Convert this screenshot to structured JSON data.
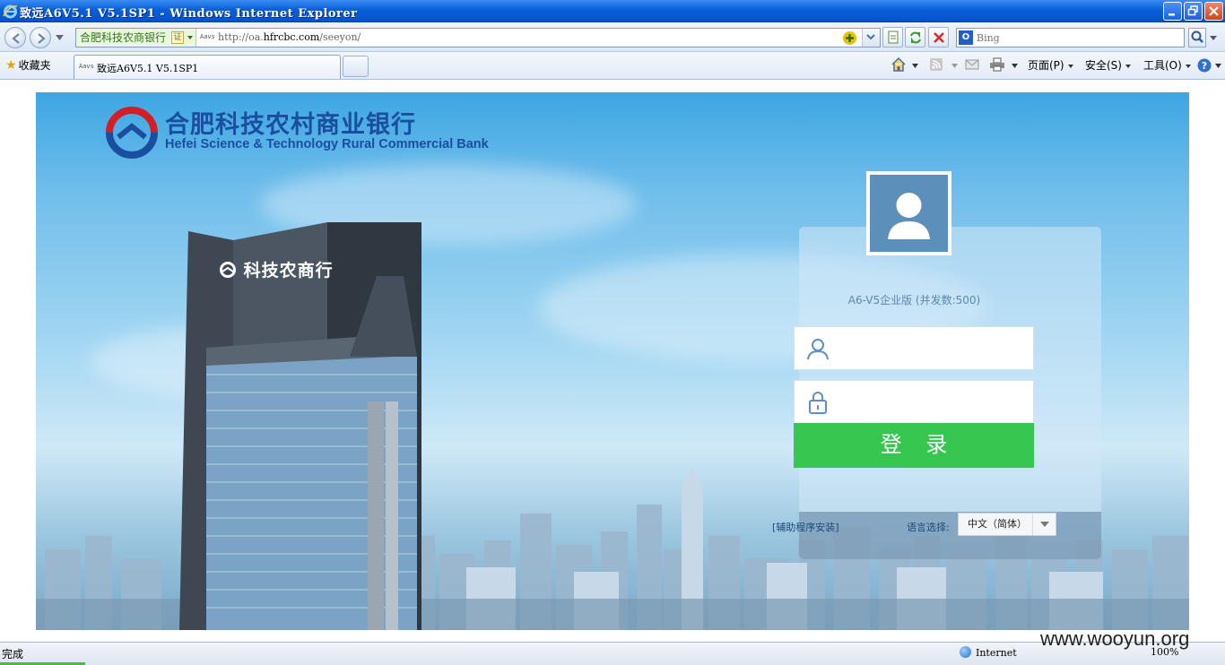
{
  "window": {
    "title": "致远A6V5.1 V5.1SP1 - Windows Internet Explorer"
  },
  "address_bar": {
    "site_identity": "合肥科技农商银行",
    "cert_badge": "证",
    "favicon_text": "Aavs",
    "url_prefix": "http://oa.",
    "url_host": "hfrcbc.com",
    "url_suffix": "/seeyon/"
  },
  "search": {
    "placeholder": "Bing",
    "provider_icon": "O"
  },
  "favorites": {
    "label": "收藏夹"
  },
  "tab": {
    "favicon_text": "Aavs",
    "title": "致远A6V5.1 V5.1SP1"
  },
  "command_bar": {
    "page": "页面(P)",
    "safety": "安全(S)",
    "tools": "工具(O)"
  },
  "bank": {
    "name_cn": "合肥科技农村商业银行",
    "name_en": "Hefei Science & Technology Rural Commercial Bank",
    "tower_sign": "科技农商行"
  },
  "login": {
    "edition": "A6-V5企业版 (并发数:500)",
    "username_value": "",
    "password_value": "",
    "submit_label": "登 录",
    "helper_link": "[辅助程序安装]",
    "language_label": "语言选择:",
    "language_selected": "中文（简体）"
  },
  "status_bar": {
    "status_text": "完成",
    "zone": "Internet",
    "zoom": "100%",
    "progress": 1.0
  },
  "watermark": "www.wooyun.org",
  "colors": {
    "title_bar": "#0a5fd8",
    "login_button": "#37c650",
    "brand_blue": "#1a4e9f",
    "brand_red": "#d21e26"
  }
}
